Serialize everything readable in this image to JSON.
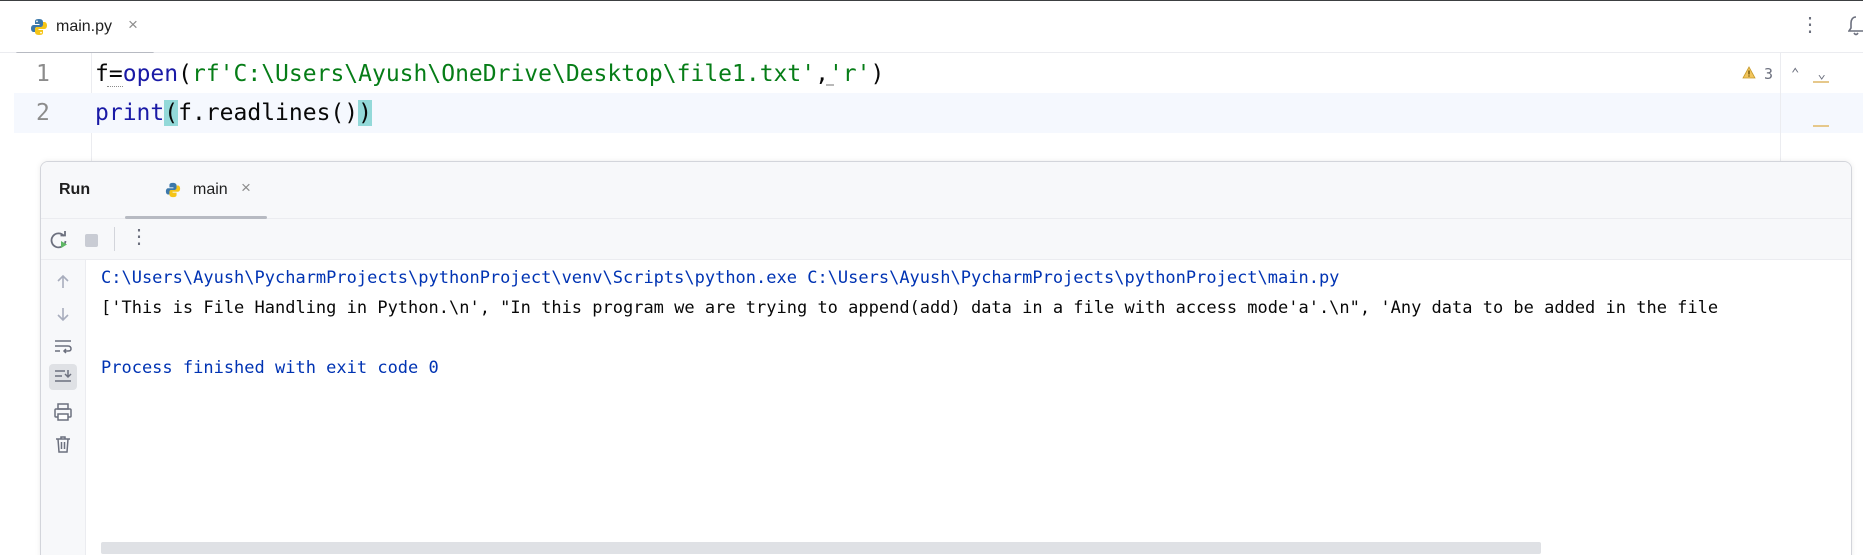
{
  "tabbar": {
    "file_tab_label": "main.py",
    "file_tab_close": "×",
    "more_menu": "⋮"
  },
  "editor": {
    "line_numbers": [
      "1",
      "2"
    ],
    "line1": {
      "var": "f",
      "eq": "=",
      "fn": "open",
      "open_paren": "(",
      "string1": "rf'C:\\Users\\Ayush\\OneDrive\\Desktop\\file1.txt'",
      "comma": ",",
      "string2": "'r'",
      "close_paren": ")"
    },
    "line2": {
      "fn": "print",
      "open_paren": "(",
      "inner": "f.readlines()",
      "close_paren": ")"
    },
    "warnings_count": "3",
    "warning_icon": "warning-icon",
    "nav_up": "⌃",
    "nav_down": "⌄"
  },
  "run_panel": {
    "title": "Run",
    "tab_label": "main",
    "tab_close": "×",
    "toolbar_more": "⋮",
    "console": {
      "command": "C:\\Users\\Ayush\\PycharmProjects\\pythonProject\\venv\\Scripts\\python.exe C:\\Users\\Ayush\\PycharmProjects\\pythonProject\\main.py",
      "output": "['This is File Handling in Python.\\n', \"In this program we are trying to append(add) data in a file with access mode'a'.\\n\", 'Any data to be added in the file",
      "exit": "Process finished with exit code 0"
    }
  },
  "colors": {
    "keyword_fn": "#1a1aa6",
    "string": "#067d17",
    "brace_highlight": "#93d9d9",
    "console_system": "#0033b3",
    "console_output": "#080808"
  }
}
